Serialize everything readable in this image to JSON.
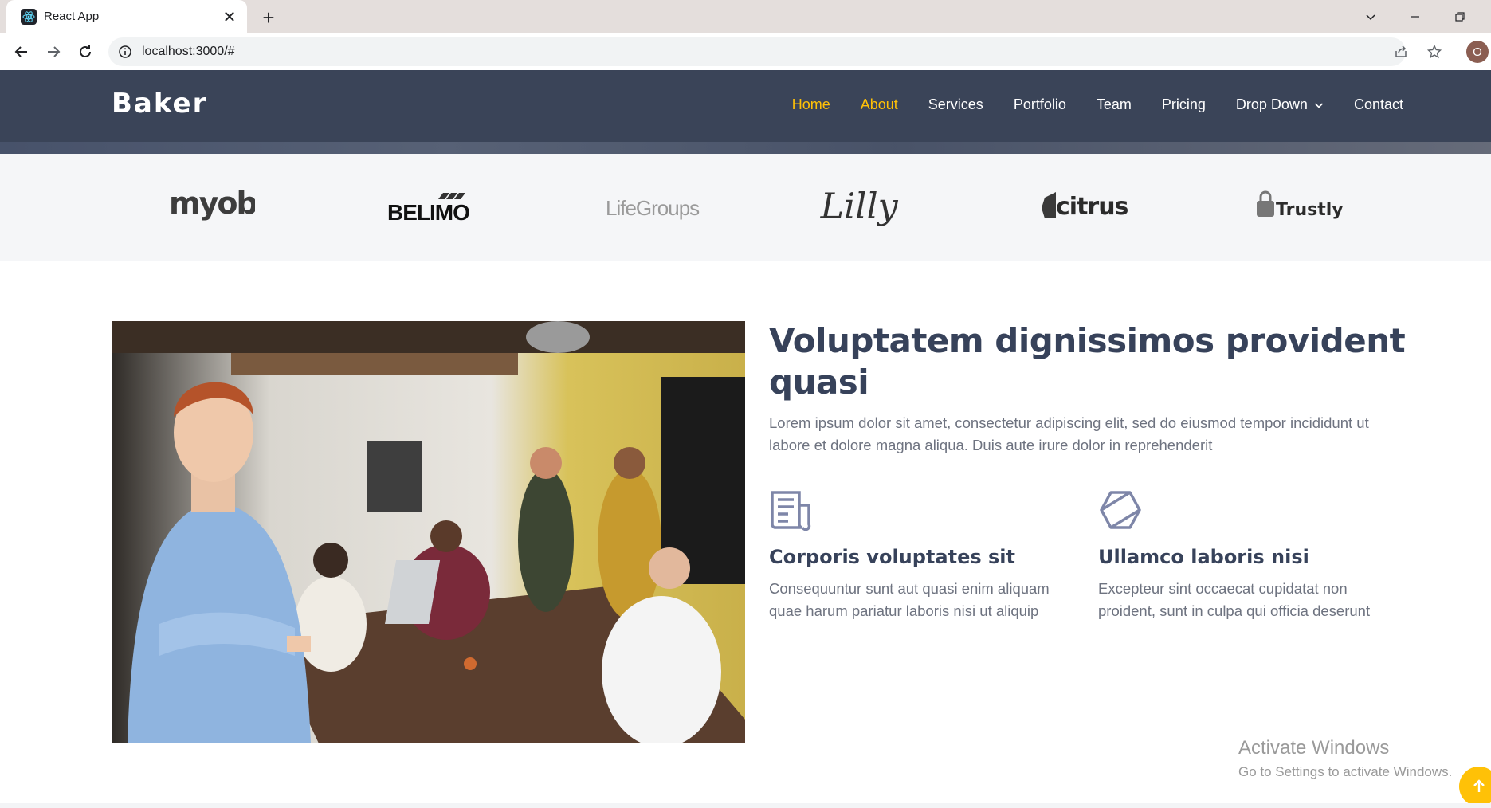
{
  "browser": {
    "tab_title": "React App",
    "url": "localhost:3000/#",
    "profile_initial": "O"
  },
  "site": {
    "logo": "Baker",
    "nav": [
      {
        "label": "Home",
        "active": true
      },
      {
        "label": "About",
        "active": true
      },
      {
        "label": "Services",
        "active": false
      },
      {
        "label": "Portfolio",
        "active": false
      },
      {
        "label": "Team",
        "active": false
      },
      {
        "label": "Pricing",
        "active": false
      },
      {
        "label": "Drop Down",
        "active": false
      },
      {
        "label": "Contact",
        "active": false
      }
    ],
    "accent_color": "#ffc107",
    "header_color": "#3a4458"
  },
  "clients": [
    "myob",
    "BELIMO",
    "LifeGroups",
    "Lilly",
    "citrus",
    "Trustly"
  ],
  "about": {
    "title": "Voluptatem dignissimos provident quasi",
    "text": "Lorem ipsum dolor sit amet, consectetur adipiscing elit, sed do eiusmod tempor incididunt ut labore et dolore magna aliqua. Duis aute irure dolor in reprehenderit",
    "features": [
      {
        "icon": "newspaper-icon",
        "title": "Corporis voluptates sit",
        "text": "Consequuntur sunt aut quasi enim aliquam quae harum pariatur laboris nisi ut aliquip"
      },
      {
        "icon": "hexagon-icon",
        "title": "Ullamco laboris nisi",
        "text": "Excepteur sint occaecat cupidatat non proident, sunt in culpa qui officia deserunt"
      }
    ]
  },
  "watermark": {
    "title": "Activate Windows",
    "subtitle": "Go to Settings to activate Windows."
  }
}
